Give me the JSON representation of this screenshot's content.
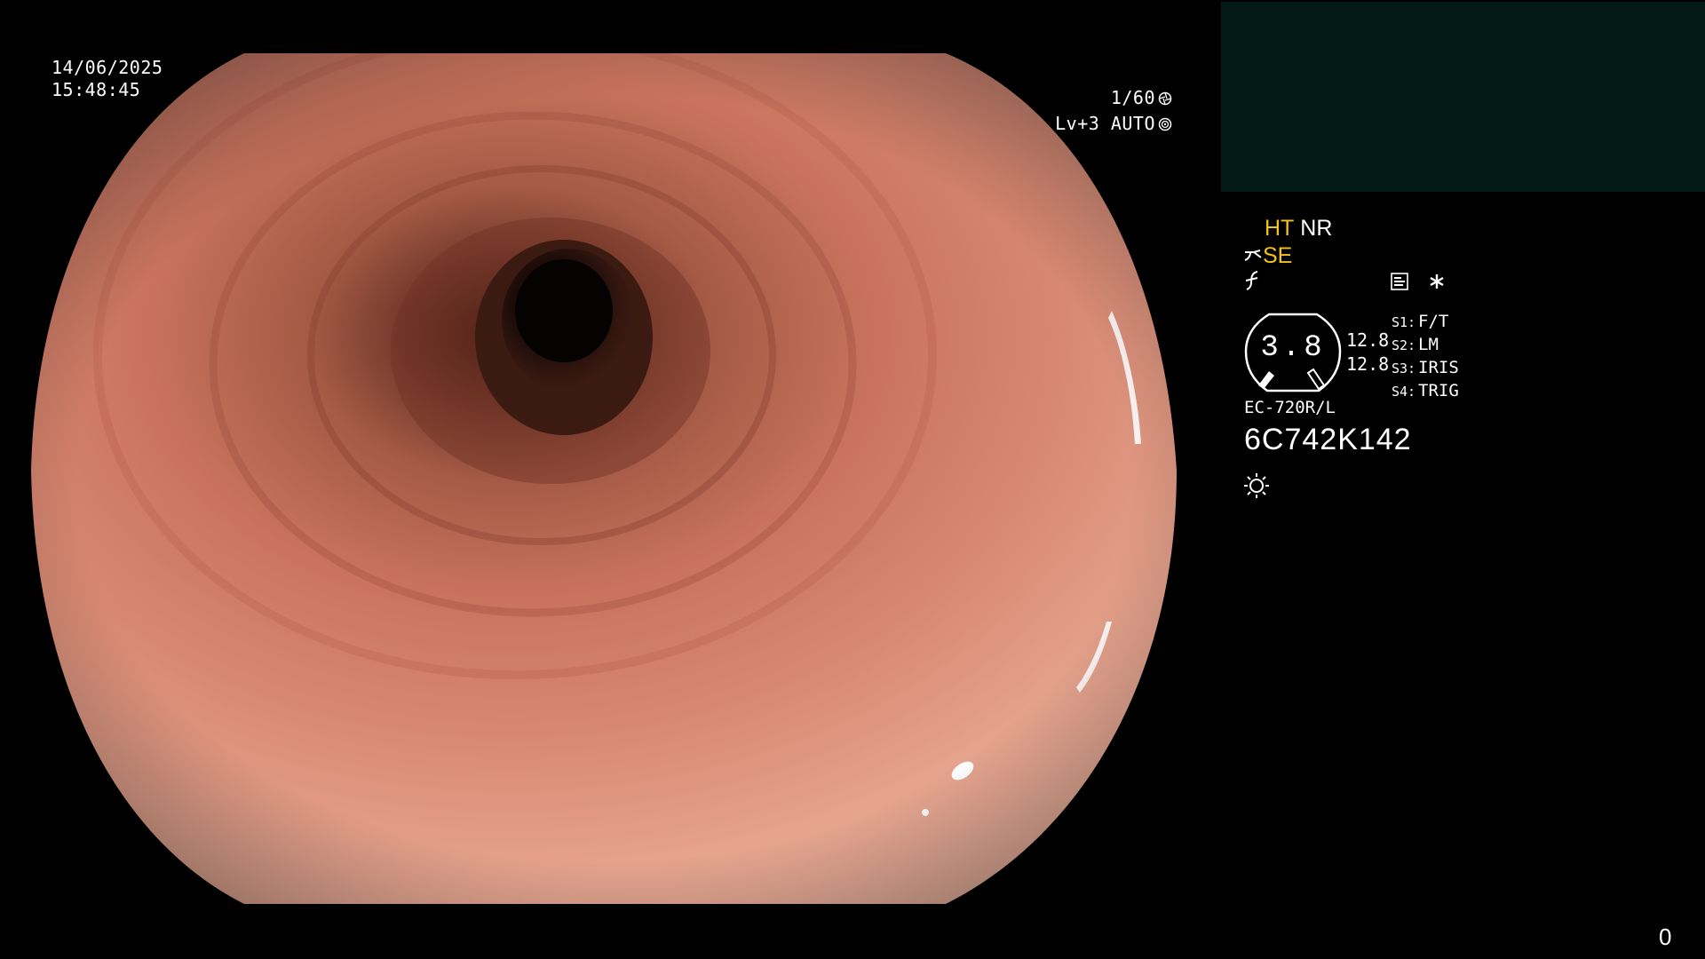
{
  "overlay": {
    "date": "14/06/2025",
    "time": "15:48:45",
    "shutter": "1/60",
    "shutter_icon": "aperture-icon",
    "level": "Lv+3 AUTO",
    "level_icon": "iris-icon"
  },
  "panel": {
    "pip_color": "#041a17",
    "mode_ht": "HT",
    "mode_nr": "NR",
    "mode_se": "SE",
    "mode_se_icon": "structure-enhance-icon",
    "mode_row3_icon": "color-enhance-icon",
    "tool_icons": [
      "record-icon",
      "asterisk-icon"
    ],
    "zoom": "3.8",
    "gain_top": "12.8",
    "gain_bottom": "12.8",
    "switches": [
      {
        "key": "S1:",
        "label": "F/T"
      },
      {
        "key": "S2:",
        "label": "LM"
      },
      {
        "key": "S3:",
        "label": "IRIS"
      },
      {
        "key": "S4:",
        "label": "TRIG"
      }
    ],
    "scope_model": "EC-720R/L",
    "scope_serial": "6C742K142",
    "light_icon": "light-source-icon",
    "frame_count": "0"
  },
  "colors": {
    "accent_yellow": "#f2c21a",
    "mucosa": "#d7826f",
    "lumen": "#2a130e"
  }
}
